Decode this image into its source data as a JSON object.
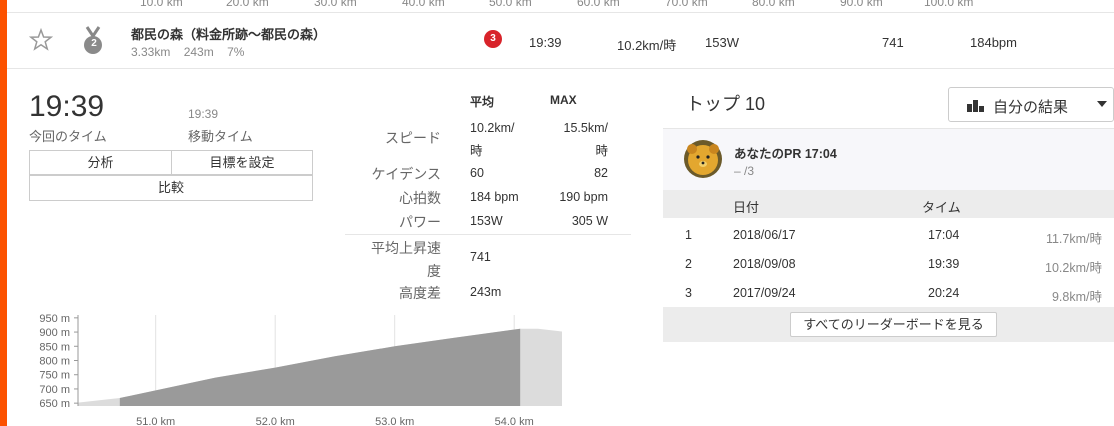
{
  "top_axis_ticks": [
    "10.0 km",
    "20.0 km",
    "30.0 km",
    "40.0 km",
    "50.0 km",
    "60.0 km",
    "70.0 km",
    "80.0 km",
    "90.0 km",
    "100.0 km"
  ],
  "segment": {
    "name": "都民の森（料金所跡〜都民の森）",
    "distance": "3.33km",
    "elevation": "243m",
    "grade": "7%",
    "medal_rank": "2",
    "kom_rank": "3",
    "time": "19:39",
    "speed": "10.2km/時",
    "power": "153W",
    "vam": "741",
    "heart_rate": "184bpm"
  },
  "summary": {
    "elapsed_time": "19:39",
    "elapsed_label": "今回のタイム",
    "moving_time": "19:39",
    "moving_label": "移動タイム",
    "analyze_label": "分析",
    "goal_label": "目標を設定",
    "compare_label": "比較"
  },
  "stats": {
    "header_avg": "平均",
    "header_max": "MAX",
    "speed_label": "スピード",
    "speed_avg_line1": "10.2km/",
    "speed_avg_line2": "時",
    "speed_max_line1": "15.5km/",
    "speed_max_line2": "時",
    "cadence_label": "ケイデンス",
    "cadence_avg": "60",
    "cadence_max": "82",
    "hr_label": "心拍数",
    "hr_avg": "184 bpm",
    "hr_max": "190 bpm",
    "power_label": "パワー",
    "power_avg": "153W",
    "power_max": "305 W",
    "vam_label_line1": "平均上昇速",
    "vam_label_line2": "度",
    "vam_value": "741",
    "elev_label": "高度差",
    "elev_value": "243m"
  },
  "leaderboard": {
    "title": "トップ 10",
    "filter_label": "自分の結果",
    "pr_label": "あなたのPR 17:04",
    "pr_rank": "– /3",
    "col_date": "日付",
    "col_time": "タイム",
    "rows": [
      {
        "rank": "1",
        "date": "2018/06/17",
        "time": "17:04",
        "speed": "11.7km/時"
      },
      {
        "rank": "2",
        "date": "2018/09/08",
        "time": "19:39",
        "speed": "10.2km/時"
      },
      {
        "rank": "3",
        "date": "2017/09/24",
        "time": "20:24",
        "speed": "9.8km/時"
      }
    ],
    "view_all_label": "すべてのリーダーボードを見る"
  },
  "chart_data": {
    "type": "area",
    "title": "",
    "xlabel": "",
    "ylabel": "",
    "y_ticks": [
      "950 m",
      "900 m",
      "850 m",
      "800 m",
      "750 m",
      "700 m",
      "650 m"
    ],
    "x_ticks": [
      "51.0 km",
      "52.0 km",
      "53.0 km",
      "54.0 km"
    ],
    "ylim": [
      640,
      960
    ],
    "xlim": [
      50.35,
      54.4
    ],
    "segment_range": [
      50.7,
      54.05
    ],
    "x": [
      50.35,
      50.7,
      51.0,
      51.5,
      52.0,
      52.5,
      53.0,
      53.5,
      54.05,
      54.2,
      54.4
    ],
    "y": [
      652,
      668,
      695,
      740,
      775,
      815,
      850,
      880,
      912,
      912,
      902
    ],
    "colors": {
      "segment_fill": "#9a9a9a",
      "outside_fill": "#dcdcdc"
    }
  }
}
